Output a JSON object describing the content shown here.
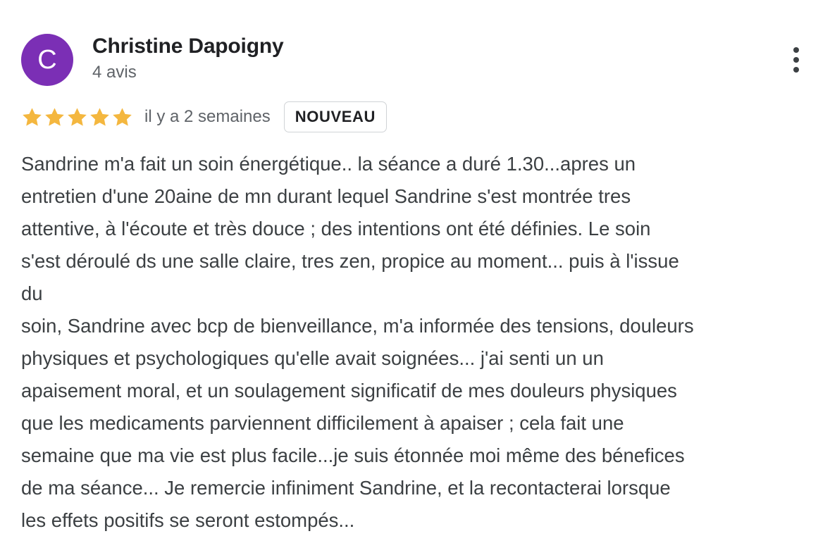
{
  "review": {
    "author": {
      "initial": "C",
      "name": "Christine Dapoigny",
      "review_count": "4 avis",
      "avatar_color": "#7b2fb5"
    },
    "rating": {
      "stars": 5,
      "max": 5,
      "star_color": "#f4b73f"
    },
    "date": "il y a 2 semaines",
    "badge": "NOUVEAU",
    "more_menu_icon": "more-vert-icon",
    "text_lines": [
      "Sandrine m'a fait un soin énergétique.. la séance a duré 1.30...apres un",
      "entretien d'une 20aine de mn durant lequel Sandrine s'est montrée tres",
      "attentive, à l'écoute et très douce ; des intentions ont été définies. Le soin",
      "s'est déroulé ds une salle claire, tres zen, propice au moment... puis à l'issue",
      "du",
      "soin, Sandrine avec bcp de bienveillance, m'a informée des tensions, douleurs",
      "physiques et psychologiques qu'elle avait soignées... j'ai senti un un",
      "apaisement moral, et un soulagement significatif de mes douleurs physiques",
      "que les medicaments parviennent difficilement à apaiser ; cela fait une",
      "semaine que ma vie est plus facile...je suis étonnée moi même des bénefices",
      "de ma séance... Je remercie infiniment Sandrine, et la recontacterai lorsque",
      "les effets positifs se seront estompés..."
    ]
  }
}
